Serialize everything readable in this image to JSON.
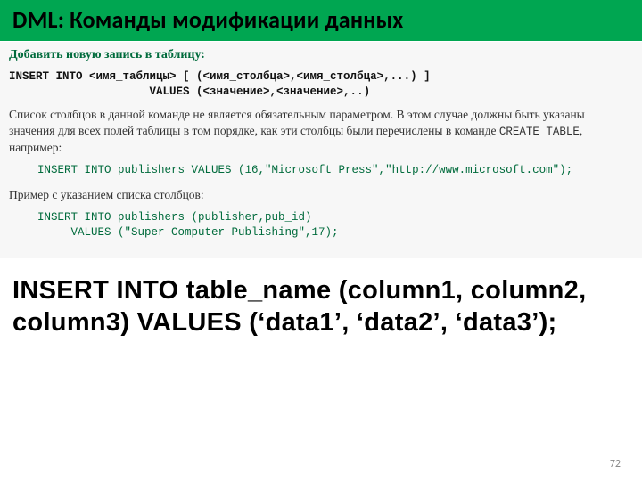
{
  "header": {
    "title": "DML: Команды модификации данных"
  },
  "body": {
    "subtitle": "Добавить новую запись в таблицу:",
    "syntax_line1": "INSERT INTO <имя_таблицы> [ (<имя_столбца>,<имя_столбца>,...) ]",
    "syntax_line2": "                     VALUES (<значение>,<значение>,..)",
    "paragraph1_a": "Список столбцов в данной команде не является обязательным параметром. В этом случае должны быть указаны значения для всех полей таблицы в том порядке, как эти столбцы были перечислены в команде ",
    "paragraph1_mono": "CREATE TABLE",
    "paragraph1_b": ", например:",
    "example1": "INSERT INTO publishers VALUES (16,\"Microsoft Press\",\"http://www.microsoft.com\");",
    "paragraph2": "Пример с указанием списка столбцов:",
    "example2_line1": "INSERT INTO publishers (publisher,pub_id)",
    "example2_line2": "     VALUES (\"Super Computer Publishing\",17);",
    "big_syntax": "INSERT INTO table_name (column1, column2, column3) VALUES (‘data1’, ‘data2’, ‘data3’);"
  },
  "page_number": "72"
}
